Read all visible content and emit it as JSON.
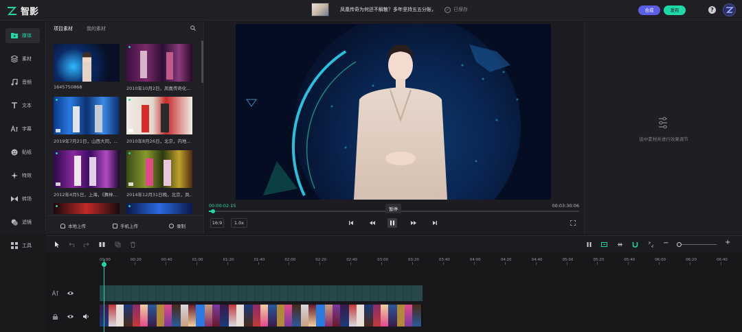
{
  "app": {
    "name": "智影",
    "project_title": "凤凰传奇为何还不解散？多年坚持五五分账，",
    "save_status": "已保存",
    "synthesize_label": "合成",
    "publish_label": "发布",
    "help_icon": "question-circle-icon"
  },
  "colors": {
    "accent": "#1fd8a8",
    "brand_purple": "#5b5fe6",
    "bg": "#1a1a1d"
  },
  "nav": [
    {
      "label": "媒体",
      "icon": "folder-icon",
      "active": true
    },
    {
      "label": "素材",
      "icon": "layers-icon"
    },
    {
      "label": "音频",
      "icon": "music-note-icon"
    },
    {
      "label": "文本",
      "icon": "text-t-icon"
    },
    {
      "label": "字幕",
      "icon": "subtitle-icon"
    },
    {
      "label": "贴纸",
      "icon": "sticker-icon"
    },
    {
      "label": "特效",
      "icon": "sparkle-icon"
    },
    {
      "label": "转场",
      "icon": "transition-icon"
    },
    {
      "label": "滤镜",
      "icon": "filter-icon"
    },
    {
      "label": "工具",
      "icon": "grid-icon"
    }
  ],
  "media": {
    "tabs": [
      "项目素材",
      "我的素材"
    ],
    "items": [
      {
        "caption": "1645750868"
      },
      {
        "caption": "2010年10月2日，凤凰传奇化..."
      },
      {
        "caption": "2019年7月21日，山西大同，..."
      },
      {
        "caption": "2010年8月26日，北京，内地..."
      },
      {
        "caption": "2012年4月5日，上海，《舞林..."
      },
      {
        "caption": "2014年12月31日晚，北京，凤..."
      },
      {
        "caption": ""
      },
      {
        "caption": ""
      }
    ],
    "footer": {
      "local_upload": "本地上传",
      "phone_upload": "手机上传",
      "record": "录制"
    }
  },
  "preview": {
    "current_time": "00:00:02:15",
    "total_time": "00:03:30:06",
    "progress": 0.012,
    "tooltip": "暂停",
    "aspect": "16:9",
    "speed": "1.0x"
  },
  "right_panel": {
    "hint": "选中素材并进行效果调节"
  },
  "timeline": {
    "ruler": [
      "00:00",
      "00:20",
      "00:40",
      "01:00",
      "01:20",
      "01:40",
      "02:00",
      "02:20",
      "02:40",
      "03:00",
      "03:20",
      "03:40",
      "04:00",
      "04:20",
      "04:40",
      "05:00",
      "05:20",
      "05:40",
      "06:00",
      "06:20",
      "06:40"
    ]
  }
}
